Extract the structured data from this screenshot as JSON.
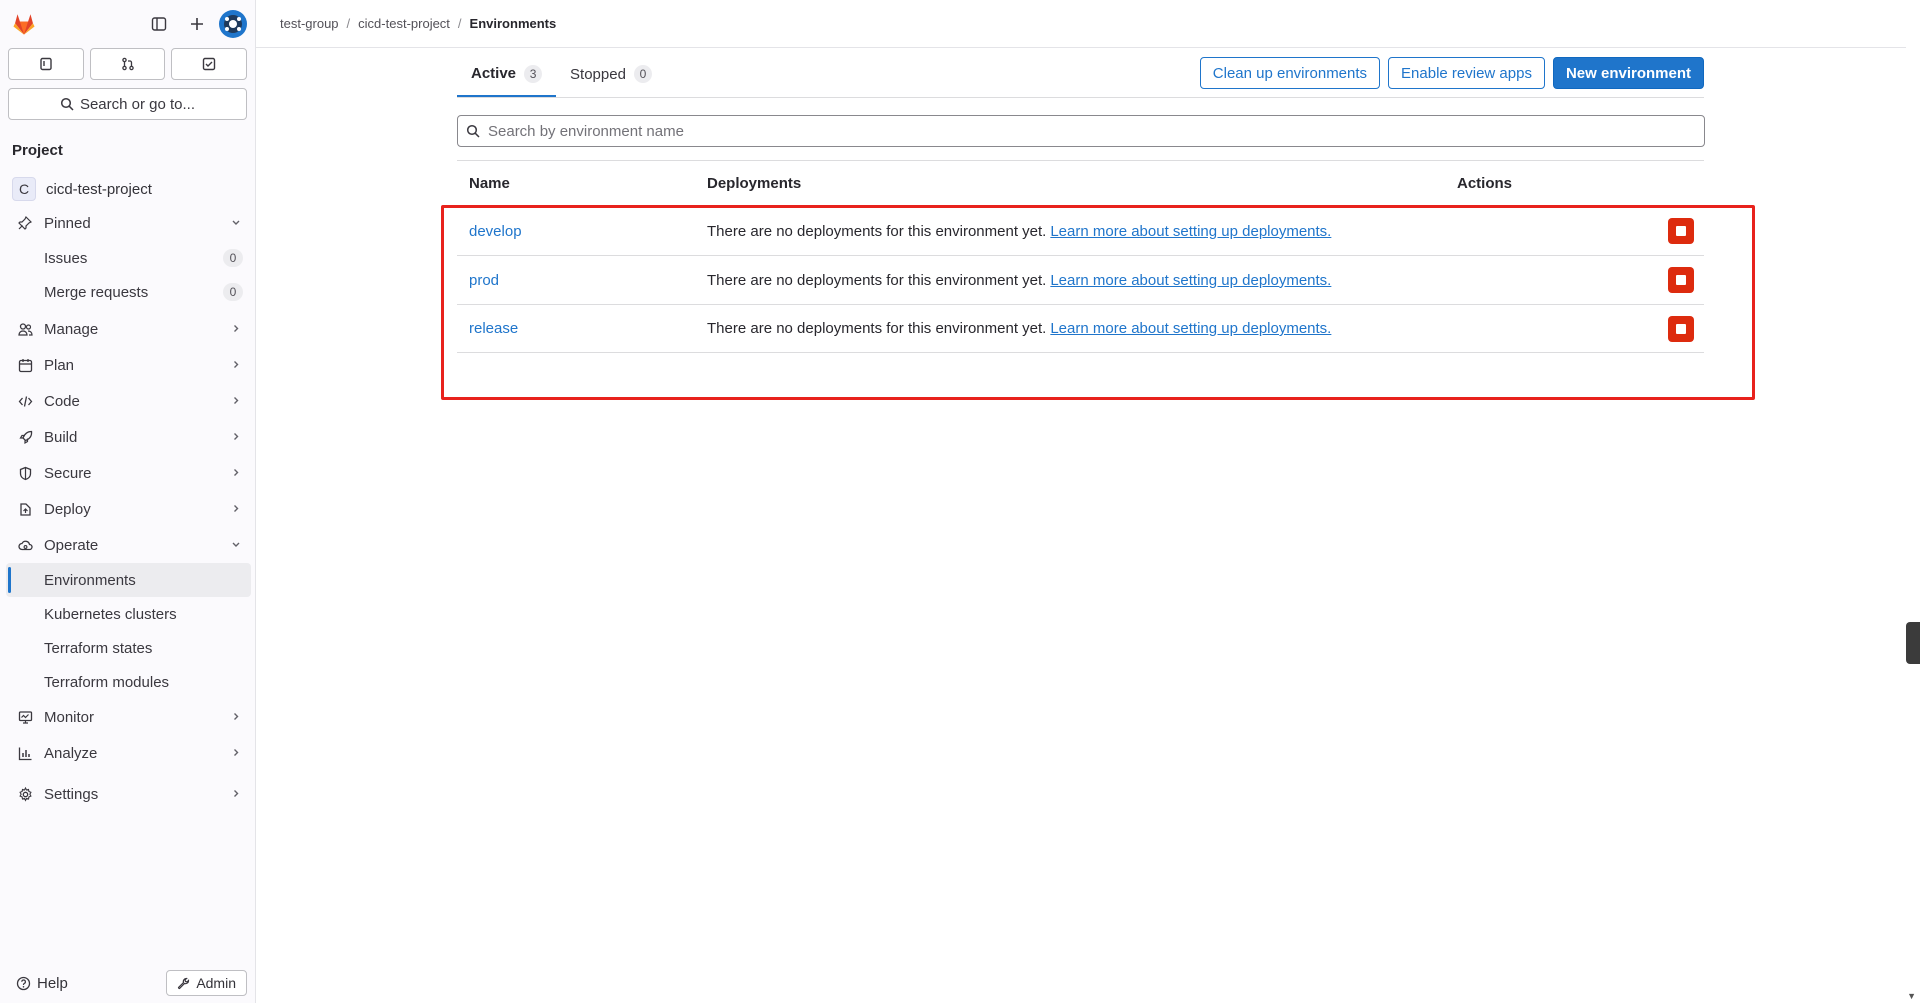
{
  "sidebar": {
    "section_title": "Project",
    "project_initial": "C",
    "project_name": "cicd-test-project",
    "search_placeholder": "Search or go to...",
    "pinned": {
      "label": "Pinned",
      "items": [
        {
          "label": "Issues",
          "count": "0"
        },
        {
          "label": "Merge requests",
          "count": "0"
        }
      ]
    },
    "nav": [
      {
        "label": "Manage",
        "icon": "users-icon"
      },
      {
        "label": "Plan",
        "icon": "planning-icon"
      },
      {
        "label": "Code",
        "icon": "code-icon"
      },
      {
        "label": "Build",
        "icon": "rocket-icon"
      },
      {
        "label": "Secure",
        "icon": "shield-icon"
      },
      {
        "label": "Deploy",
        "icon": "deploy-icon"
      }
    ],
    "operate": {
      "label": "Operate",
      "items": [
        {
          "label": "Environments",
          "active": true
        },
        {
          "label": "Kubernetes clusters"
        },
        {
          "label": "Terraform states"
        },
        {
          "label": "Terraform modules"
        }
      ]
    },
    "nav2": [
      {
        "label": "Monitor",
        "icon": "monitor-icon"
      },
      {
        "label": "Analyze",
        "icon": "chart-icon"
      }
    ],
    "settings_label": "Settings",
    "help_label": "Help",
    "admin_label": "Admin"
  },
  "breadcrumb": [
    "test-group",
    "cicd-test-project",
    "Environments"
  ],
  "tabs": [
    {
      "label": "Active",
      "count": "3"
    },
    {
      "label": "Stopped",
      "count": "0"
    }
  ],
  "buttons": {
    "cleanup": "Clean up environments",
    "review_apps": "Enable review apps",
    "new_env": "New environment"
  },
  "search": {
    "placeholder": "Search by environment name"
  },
  "table": {
    "headers": {
      "name": "Name",
      "deployments": "Deployments",
      "actions": "Actions"
    },
    "rows": [
      {
        "name": "develop",
        "deployments": "There are no deployments for this environment yet.",
        "link": "Learn more about setting up deployments."
      },
      {
        "name": "prod",
        "deployments": "There are no deployments for this environment yet.",
        "link": "Learn more about setting up deployments."
      },
      {
        "name": "release",
        "deployments": "There are no deployments for this environment yet.",
        "link": "Learn more about setting up deployments."
      }
    ]
  },
  "colors": {
    "accent": "#1f75cb",
    "danger": "#dd2b0e",
    "highlight": "#e8221c"
  }
}
